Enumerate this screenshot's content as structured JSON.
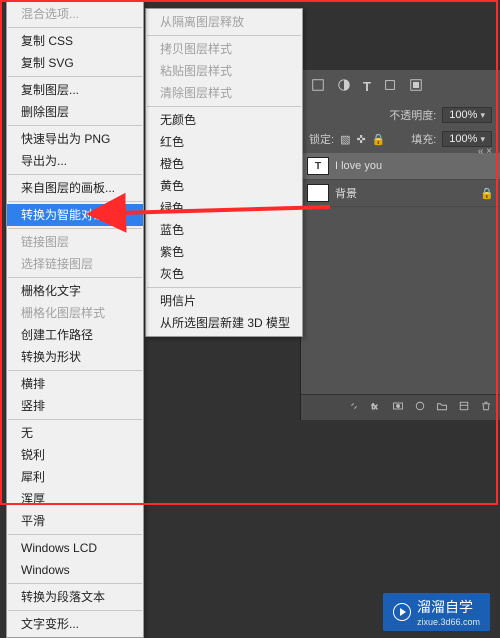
{
  "context_menu": {
    "items": [
      {
        "label": "混合选项...",
        "disabled": true
      },
      "sep",
      {
        "label": "复制 CSS"
      },
      {
        "label": "复制 SVG"
      },
      "sep",
      {
        "label": "复制图层..."
      },
      {
        "label": "删除图层"
      },
      "sep",
      {
        "label": "快速导出为 PNG"
      },
      {
        "label": "导出为..."
      },
      "sep",
      {
        "label": "来自图层的画板..."
      },
      "sep",
      {
        "label": "转换为智能对象",
        "highlight": true
      },
      "sep",
      {
        "label": "链接图层",
        "disabled": true
      },
      {
        "label": "选择链接图层",
        "disabled": true
      },
      "sep",
      {
        "label": "栅格化文字"
      },
      {
        "label": "栅格化图层样式",
        "disabled": true
      },
      {
        "label": "创建工作路径"
      },
      {
        "label": "转换为形状"
      },
      "sep",
      {
        "label": "横排"
      },
      {
        "label": "竖排"
      },
      "sep",
      {
        "label": "无"
      },
      {
        "label": "锐利"
      },
      {
        "label": "犀利"
      },
      {
        "label": "浑厚"
      },
      {
        "label": "平滑"
      },
      "sep",
      {
        "label": "Windows LCD"
      },
      {
        "label": "Windows"
      },
      "sep",
      {
        "label": "转换为段落文本"
      },
      "sep",
      {
        "label": "文字变形..."
      }
    ]
  },
  "submenu": {
    "items": [
      {
        "label": "从隔离图层释放",
        "disabled": true
      },
      "sep",
      {
        "label": "拷贝图层样式",
        "disabled": true
      },
      {
        "label": "粘贴图层样式",
        "disabled": true
      },
      {
        "label": "清除图层样式",
        "disabled": true
      },
      "sep",
      {
        "label": "无颜色"
      },
      {
        "label": "红色"
      },
      {
        "label": "橙色"
      },
      {
        "label": "黄色"
      },
      {
        "label": "绿色"
      },
      {
        "label": "蓝色"
      },
      {
        "label": "紫色"
      },
      {
        "label": "灰色"
      },
      "sep",
      {
        "label": "明信片"
      },
      {
        "label": "从所选图层新建 3D 模型"
      }
    ]
  },
  "panel": {
    "opacity_label": "不透明度:",
    "opacity_value": "100%",
    "lock_label": "锁定:",
    "fill_label": "填充:",
    "fill_value": "100%",
    "layers": [
      {
        "name": "I love you",
        "type": "text",
        "selected": true
      },
      {
        "name": "背景",
        "type": "bg",
        "locked": true
      }
    ]
  },
  "watermark": {
    "text": "溜溜自学",
    "url": "zixue.3d66.com"
  }
}
